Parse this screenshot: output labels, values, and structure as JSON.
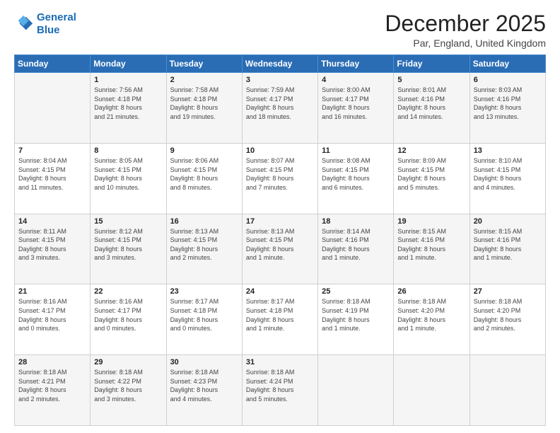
{
  "header": {
    "logo_line1": "General",
    "logo_line2": "Blue",
    "title": "December 2025",
    "subtitle": "Par, England, United Kingdom"
  },
  "calendar": {
    "headers": [
      "Sunday",
      "Monday",
      "Tuesday",
      "Wednesday",
      "Thursday",
      "Friday",
      "Saturday"
    ],
    "rows": [
      [
        {
          "day": "",
          "info": ""
        },
        {
          "day": "1",
          "info": "Sunrise: 7:56 AM\nSunset: 4:18 PM\nDaylight: 8 hours\nand 21 minutes."
        },
        {
          "day": "2",
          "info": "Sunrise: 7:58 AM\nSunset: 4:18 PM\nDaylight: 8 hours\nand 19 minutes."
        },
        {
          "day": "3",
          "info": "Sunrise: 7:59 AM\nSunset: 4:17 PM\nDaylight: 8 hours\nand 18 minutes."
        },
        {
          "day": "4",
          "info": "Sunrise: 8:00 AM\nSunset: 4:17 PM\nDaylight: 8 hours\nand 16 minutes."
        },
        {
          "day": "5",
          "info": "Sunrise: 8:01 AM\nSunset: 4:16 PM\nDaylight: 8 hours\nand 14 minutes."
        },
        {
          "day": "6",
          "info": "Sunrise: 8:03 AM\nSunset: 4:16 PM\nDaylight: 8 hours\nand 13 minutes."
        }
      ],
      [
        {
          "day": "7",
          "info": "Sunrise: 8:04 AM\nSunset: 4:15 PM\nDaylight: 8 hours\nand 11 minutes."
        },
        {
          "day": "8",
          "info": "Sunrise: 8:05 AM\nSunset: 4:15 PM\nDaylight: 8 hours\nand 10 minutes."
        },
        {
          "day": "9",
          "info": "Sunrise: 8:06 AM\nSunset: 4:15 PM\nDaylight: 8 hours\nand 8 minutes."
        },
        {
          "day": "10",
          "info": "Sunrise: 8:07 AM\nSunset: 4:15 PM\nDaylight: 8 hours\nand 7 minutes."
        },
        {
          "day": "11",
          "info": "Sunrise: 8:08 AM\nSunset: 4:15 PM\nDaylight: 8 hours\nand 6 minutes."
        },
        {
          "day": "12",
          "info": "Sunrise: 8:09 AM\nSunset: 4:15 PM\nDaylight: 8 hours\nand 5 minutes."
        },
        {
          "day": "13",
          "info": "Sunrise: 8:10 AM\nSunset: 4:15 PM\nDaylight: 8 hours\nand 4 minutes."
        }
      ],
      [
        {
          "day": "14",
          "info": "Sunrise: 8:11 AM\nSunset: 4:15 PM\nDaylight: 8 hours\nand 3 minutes."
        },
        {
          "day": "15",
          "info": "Sunrise: 8:12 AM\nSunset: 4:15 PM\nDaylight: 8 hours\nand 3 minutes."
        },
        {
          "day": "16",
          "info": "Sunrise: 8:13 AM\nSunset: 4:15 PM\nDaylight: 8 hours\nand 2 minutes."
        },
        {
          "day": "17",
          "info": "Sunrise: 8:13 AM\nSunset: 4:15 PM\nDaylight: 8 hours\nand 1 minute."
        },
        {
          "day": "18",
          "info": "Sunrise: 8:14 AM\nSunset: 4:16 PM\nDaylight: 8 hours\nand 1 minute."
        },
        {
          "day": "19",
          "info": "Sunrise: 8:15 AM\nSunset: 4:16 PM\nDaylight: 8 hours\nand 1 minute."
        },
        {
          "day": "20",
          "info": "Sunrise: 8:15 AM\nSunset: 4:16 PM\nDaylight: 8 hours\nand 1 minute."
        }
      ],
      [
        {
          "day": "21",
          "info": "Sunrise: 8:16 AM\nSunset: 4:17 PM\nDaylight: 8 hours\nand 0 minutes."
        },
        {
          "day": "22",
          "info": "Sunrise: 8:16 AM\nSunset: 4:17 PM\nDaylight: 8 hours\nand 0 minutes."
        },
        {
          "day": "23",
          "info": "Sunrise: 8:17 AM\nSunset: 4:18 PM\nDaylight: 8 hours\nand 0 minutes."
        },
        {
          "day": "24",
          "info": "Sunrise: 8:17 AM\nSunset: 4:18 PM\nDaylight: 8 hours\nand 1 minute."
        },
        {
          "day": "25",
          "info": "Sunrise: 8:18 AM\nSunset: 4:19 PM\nDaylight: 8 hours\nand 1 minute."
        },
        {
          "day": "26",
          "info": "Sunrise: 8:18 AM\nSunset: 4:20 PM\nDaylight: 8 hours\nand 1 minute."
        },
        {
          "day": "27",
          "info": "Sunrise: 8:18 AM\nSunset: 4:20 PM\nDaylight: 8 hours\nand 2 minutes."
        }
      ],
      [
        {
          "day": "28",
          "info": "Sunrise: 8:18 AM\nSunset: 4:21 PM\nDaylight: 8 hours\nand 2 minutes."
        },
        {
          "day": "29",
          "info": "Sunrise: 8:18 AM\nSunset: 4:22 PM\nDaylight: 8 hours\nand 3 minutes."
        },
        {
          "day": "30",
          "info": "Sunrise: 8:18 AM\nSunset: 4:23 PM\nDaylight: 8 hours\nand 4 minutes."
        },
        {
          "day": "31",
          "info": "Sunrise: 8:18 AM\nSunset: 4:24 PM\nDaylight: 8 hours\nand 5 minutes."
        },
        {
          "day": "",
          "info": ""
        },
        {
          "day": "",
          "info": ""
        },
        {
          "day": "",
          "info": ""
        }
      ]
    ]
  }
}
